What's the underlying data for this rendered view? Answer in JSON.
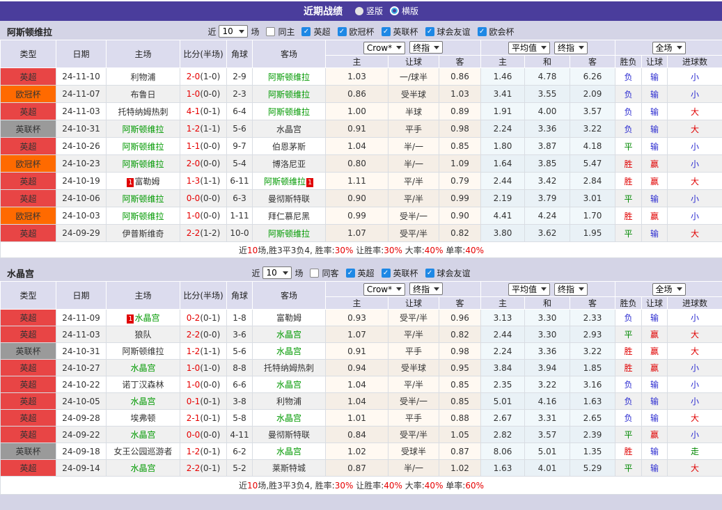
{
  "topbar": {
    "title": "近期战绩",
    "options": [
      {
        "label": "竖版",
        "selected": true
      },
      {
        "label": "横版",
        "selected": false
      }
    ]
  },
  "filter": {
    "near": "近",
    "count": "10",
    "games": "场"
  },
  "columns": {
    "type": "类型",
    "date": "日期",
    "home": "主场",
    "score": "比分(半场)",
    "corner": "角球",
    "away": "客场",
    "crow_select": "Crow*",
    "final_select": "终指",
    "avg_select": "平均值",
    "full_select": "全场",
    "sub": [
      "主",
      "让球",
      "客",
      "主",
      "和",
      "客",
      "胜负",
      "让球",
      "进球数"
    ]
  },
  "colors": {
    "league": {
      "英超": "#e84545",
      "欧冠杯": "#ff6a00",
      "英联杯": "#9a9a9a"
    },
    "result": {
      "red": "#e00000",
      "green": "#008800",
      "blue": "#2b2bd0"
    },
    "team_focus": "#009900",
    "score_red": "#e60000",
    "header_purple": "#4a3d9c",
    "checkbox_blue": "#1e88e5"
  },
  "tables": [
    {
      "team": "阿斯顿维拉",
      "same_filter": "同主",
      "leagues": [
        "英超",
        "欧冠杯",
        "英联杯",
        "球会友谊",
        "欧会杯"
      ],
      "rows": [
        {
          "league": "英超",
          "date": "24-11-10",
          "home": "利物浦",
          "home_focus": false,
          "home_card": "",
          "score": "2-0",
          "half": "(1-0)",
          "corner": "2-9",
          "away": "阿斯顿维拉",
          "away_focus": true,
          "away_card": "",
          "crow": [
            "1.03",
            "一/球半",
            "0.86"
          ],
          "avg": [
            "1.46",
            "4.78",
            "6.26"
          ],
          "result": [
            [
              "负",
              "blue"
            ],
            [
              "输",
              "blue"
            ],
            [
              "小",
              "blue"
            ]
          ]
        },
        {
          "league": "欧冠杯",
          "date": "24-11-07",
          "home": "布鲁日",
          "home_focus": false,
          "home_card": "",
          "score": "1-0",
          "half": "(0-0)",
          "corner": "2-3",
          "away": "阿斯顿维拉",
          "away_focus": true,
          "away_card": "",
          "crow": [
            "0.86",
            "受半球",
            "1.03"
          ],
          "avg": [
            "3.41",
            "3.55",
            "2.09"
          ],
          "result": [
            [
              "负",
              "blue"
            ],
            [
              "输",
              "blue"
            ],
            [
              "小",
              "blue"
            ]
          ]
        },
        {
          "league": "英超",
          "date": "24-11-03",
          "home": "托特纳姆热刺",
          "home_focus": false,
          "home_card": "",
          "score": "4-1",
          "half": "(0-1)",
          "corner": "6-4",
          "away": "阿斯顿维拉",
          "away_focus": true,
          "away_card": "",
          "crow": [
            "1.00",
            "半球",
            "0.89"
          ],
          "avg": [
            "1.91",
            "4.00",
            "3.57"
          ],
          "result": [
            [
              "负",
              "blue"
            ],
            [
              "输",
              "blue"
            ],
            [
              "大",
              "red"
            ]
          ]
        },
        {
          "league": "英联杯",
          "date": "24-10-31",
          "home": "阿斯顿维拉",
          "home_focus": true,
          "home_card": "",
          "score": "1-2",
          "half": "(1-1)",
          "corner": "5-6",
          "away": "水晶宫",
          "away_focus": false,
          "away_card": "",
          "crow": [
            "0.91",
            "平手",
            "0.98"
          ],
          "avg": [
            "2.24",
            "3.36",
            "3.22"
          ],
          "result": [
            [
              "负",
              "blue"
            ],
            [
              "输",
              "blue"
            ],
            [
              "大",
              "red"
            ]
          ]
        },
        {
          "league": "英超",
          "date": "24-10-26",
          "home": "阿斯顿维拉",
          "home_focus": true,
          "home_card": "",
          "score": "1-1",
          "half": "(0-0)",
          "corner": "9-7",
          "away": "伯恩茅斯",
          "away_focus": false,
          "away_card": "",
          "crow": [
            "1.04",
            "半/一",
            "0.85"
          ],
          "avg": [
            "1.80",
            "3.87",
            "4.18"
          ],
          "result": [
            [
              "平",
              "green"
            ],
            [
              "输",
              "blue"
            ],
            [
              "小",
              "blue"
            ]
          ]
        },
        {
          "league": "欧冠杯",
          "date": "24-10-23",
          "home": "阿斯顿维拉",
          "home_focus": true,
          "home_card": "",
          "score": "2-0",
          "half": "(0-0)",
          "corner": "5-4",
          "away": "博洛尼亚",
          "away_focus": false,
          "away_card": "",
          "crow": [
            "0.80",
            "半/一",
            "1.09"
          ],
          "avg": [
            "1.64",
            "3.85",
            "5.47"
          ],
          "result": [
            [
              "胜",
              "red"
            ],
            [
              "赢",
              "red"
            ],
            [
              "小",
              "blue"
            ]
          ]
        },
        {
          "league": "英超",
          "date": "24-10-19",
          "home": "富勒姆",
          "home_focus": false,
          "home_card": "1",
          "score": "1-3",
          "half": "(1-1)",
          "corner": "6-11",
          "away": "阿斯顿维拉",
          "away_focus": true,
          "away_card": "1",
          "crow": [
            "1.11",
            "平/半",
            "0.79"
          ],
          "avg": [
            "2.44",
            "3.42",
            "2.84"
          ],
          "result": [
            [
              "胜",
              "red"
            ],
            [
              "赢",
              "red"
            ],
            [
              "大",
              "red"
            ]
          ]
        },
        {
          "league": "英超",
          "date": "24-10-06",
          "home": "阿斯顿维拉",
          "home_focus": true,
          "home_card": "",
          "score": "0-0",
          "half": "(0-0)",
          "corner": "6-3",
          "away": "曼彻斯特联",
          "away_focus": false,
          "away_card": "",
          "crow": [
            "0.90",
            "平/半",
            "0.99"
          ],
          "avg": [
            "2.19",
            "3.79",
            "3.01"
          ],
          "result": [
            [
              "平",
              "green"
            ],
            [
              "输",
              "blue"
            ],
            [
              "小",
              "blue"
            ]
          ]
        },
        {
          "league": "欧冠杯",
          "date": "24-10-03",
          "home": "阿斯顿维拉",
          "home_focus": true,
          "home_card": "",
          "score": "1-0",
          "half": "(0-0)",
          "corner": "1-11",
          "away": "拜仁慕尼黑",
          "away_focus": false,
          "away_card": "",
          "crow": [
            "0.99",
            "受半/一",
            "0.90"
          ],
          "avg": [
            "4.41",
            "4.24",
            "1.70"
          ],
          "result": [
            [
              "胜",
              "red"
            ],
            [
              "赢",
              "red"
            ],
            [
              "小",
              "blue"
            ]
          ]
        },
        {
          "league": "英超",
          "date": "24-09-29",
          "home": "伊普斯维奇",
          "home_focus": false,
          "home_card": "",
          "score": "2-2",
          "half": "(1-2)",
          "corner": "10-0",
          "away": "阿斯顿维拉",
          "away_focus": true,
          "away_card": "",
          "crow": [
            "1.07",
            "受平/半",
            "0.82"
          ],
          "avg": [
            "3.80",
            "3.62",
            "1.95"
          ],
          "result": [
            [
              "平",
              "green"
            ],
            [
              "输",
              "blue"
            ],
            [
              "大",
              "red"
            ]
          ]
        }
      ],
      "summary": [
        {
          "text": "近"
        },
        {
          "text": "10",
          "red": true
        },
        {
          "text": "场,胜3平3负4, 胜率:"
        },
        {
          "text": "30%",
          "red": true
        },
        {
          "text": " 让胜率:"
        },
        {
          "text": "30%",
          "red": true
        },
        {
          "text": " 大率:"
        },
        {
          "text": "40%",
          "red": true
        },
        {
          "text": " 单率:"
        },
        {
          "text": "40%",
          "red": true
        }
      ]
    },
    {
      "team": "水晶宫",
      "same_filter": "同客",
      "leagues": [
        "英超",
        "英联杯",
        "球会友谊"
      ],
      "rows": [
        {
          "league": "英超",
          "date": "24-11-09",
          "home": "水晶宫",
          "home_focus": true,
          "home_card": "1",
          "score": "0-2",
          "half": "(0-1)",
          "corner": "1-8",
          "away": "富勒姆",
          "away_focus": false,
          "away_card": "",
          "crow": [
            "0.93",
            "受平/半",
            "0.96"
          ],
          "avg": [
            "3.13",
            "3.30",
            "2.33"
          ],
          "result": [
            [
              "负",
              "blue"
            ],
            [
              "输",
              "blue"
            ],
            [
              "小",
              "blue"
            ]
          ]
        },
        {
          "league": "英超",
          "date": "24-11-03",
          "home": "狼队",
          "home_focus": false,
          "home_card": "",
          "score": "2-2",
          "half": "(0-0)",
          "corner": "3-6",
          "away": "水晶宫",
          "away_focus": true,
          "away_card": "",
          "crow": [
            "1.07",
            "平/半",
            "0.82"
          ],
          "avg": [
            "2.44",
            "3.30",
            "2.93"
          ],
          "result": [
            [
              "平",
              "green"
            ],
            [
              "赢",
              "red"
            ],
            [
              "大",
              "red"
            ]
          ]
        },
        {
          "league": "英联杯",
          "date": "24-10-31",
          "home": "阿斯顿维拉",
          "home_focus": false,
          "home_card": "",
          "score": "1-2",
          "half": "(1-1)",
          "corner": "5-6",
          "away": "水晶宫",
          "away_focus": true,
          "away_card": "",
          "crow": [
            "0.91",
            "平手",
            "0.98"
          ],
          "avg": [
            "2.24",
            "3.36",
            "3.22"
          ],
          "result": [
            [
              "胜",
              "red"
            ],
            [
              "赢",
              "red"
            ],
            [
              "大",
              "red"
            ]
          ]
        },
        {
          "league": "英超",
          "date": "24-10-27",
          "home": "水晶宫",
          "home_focus": true,
          "home_card": "",
          "score": "1-0",
          "half": "(1-0)",
          "corner": "8-8",
          "away": "托特纳姆热刺",
          "away_focus": false,
          "away_card": "",
          "crow": [
            "0.94",
            "受半球",
            "0.95"
          ],
          "avg": [
            "3.84",
            "3.94",
            "1.85"
          ],
          "result": [
            [
              "胜",
              "red"
            ],
            [
              "赢",
              "red"
            ],
            [
              "小",
              "blue"
            ]
          ]
        },
        {
          "league": "英超",
          "date": "24-10-22",
          "home": "诺丁汉森林",
          "home_focus": false,
          "home_card": "",
          "score": "1-0",
          "half": "(0-0)",
          "corner": "6-6",
          "away": "水晶宫",
          "away_focus": true,
          "away_card": "",
          "crow": [
            "1.04",
            "平/半",
            "0.85"
          ],
          "avg": [
            "2.35",
            "3.22",
            "3.16"
          ],
          "result": [
            [
              "负",
              "blue"
            ],
            [
              "输",
              "blue"
            ],
            [
              "小",
              "blue"
            ]
          ]
        },
        {
          "league": "英超",
          "date": "24-10-05",
          "home": "水晶宫",
          "home_focus": true,
          "home_card": "",
          "score": "0-1",
          "half": "(0-1)",
          "corner": "3-8",
          "away": "利物浦",
          "away_focus": false,
          "away_card": "",
          "crow": [
            "1.04",
            "受半/一",
            "0.85"
          ],
          "avg": [
            "5.01",
            "4.16",
            "1.63"
          ],
          "result": [
            [
              "负",
              "blue"
            ],
            [
              "输",
              "blue"
            ],
            [
              "小",
              "blue"
            ]
          ]
        },
        {
          "league": "英超",
          "date": "24-09-28",
          "home": "埃弗顿",
          "home_focus": false,
          "home_card": "",
          "score": "2-1",
          "half": "(0-1)",
          "corner": "5-8",
          "away": "水晶宫",
          "away_focus": true,
          "away_card": "",
          "crow": [
            "1.01",
            "平手",
            "0.88"
          ],
          "avg": [
            "2.67",
            "3.31",
            "2.65"
          ],
          "result": [
            [
              "负",
              "blue"
            ],
            [
              "输",
              "blue"
            ],
            [
              "大",
              "red"
            ]
          ]
        },
        {
          "league": "英超",
          "date": "24-09-22",
          "home": "水晶宫",
          "home_focus": true,
          "home_card": "",
          "score": "0-0",
          "half": "(0-0)",
          "corner": "4-11",
          "away": "曼彻斯特联",
          "away_focus": false,
          "away_card": "",
          "crow": [
            "0.84",
            "受平/半",
            "1.05"
          ],
          "avg": [
            "2.82",
            "3.57",
            "2.39"
          ],
          "result": [
            [
              "平",
              "green"
            ],
            [
              "赢",
              "red"
            ],
            [
              "小",
              "blue"
            ]
          ]
        },
        {
          "league": "英联杯",
          "date": "24-09-18",
          "home": "女王公园巡游者",
          "home_focus": false,
          "home_card": "",
          "score": "1-2",
          "half": "(0-1)",
          "corner": "6-2",
          "away": "水晶宫",
          "away_focus": true,
          "away_card": "",
          "crow": [
            "1.02",
            "受球半",
            "0.87"
          ],
          "avg": [
            "8.06",
            "5.01",
            "1.35"
          ],
          "result": [
            [
              "胜",
              "red"
            ],
            [
              "输",
              "blue"
            ],
            [
              "走",
              "green"
            ]
          ]
        },
        {
          "league": "英超",
          "date": "24-09-14",
          "home": "水晶宫",
          "home_focus": true,
          "home_card": "",
          "score": "2-2",
          "half": "(0-1)",
          "corner": "5-2",
          "away": "莱斯特城",
          "away_focus": false,
          "away_card": "",
          "crow": [
            "0.87",
            "半/一",
            "1.02"
          ],
          "avg": [
            "1.63",
            "4.01",
            "5.29"
          ],
          "result": [
            [
              "平",
              "green"
            ],
            [
              "输",
              "blue"
            ],
            [
              "大",
              "red"
            ]
          ]
        }
      ],
      "summary": [
        {
          "text": "近"
        },
        {
          "text": "10",
          "red": true
        },
        {
          "text": "场,胜3平3负4, 胜率:"
        },
        {
          "text": "30%",
          "red": true
        },
        {
          "text": " 让胜率:"
        },
        {
          "text": "40%",
          "red": true
        },
        {
          "text": " 大率:"
        },
        {
          "text": "40%",
          "red": true
        },
        {
          "text": " 单率:"
        },
        {
          "text": "60%",
          "red": true
        }
      ]
    }
  ]
}
